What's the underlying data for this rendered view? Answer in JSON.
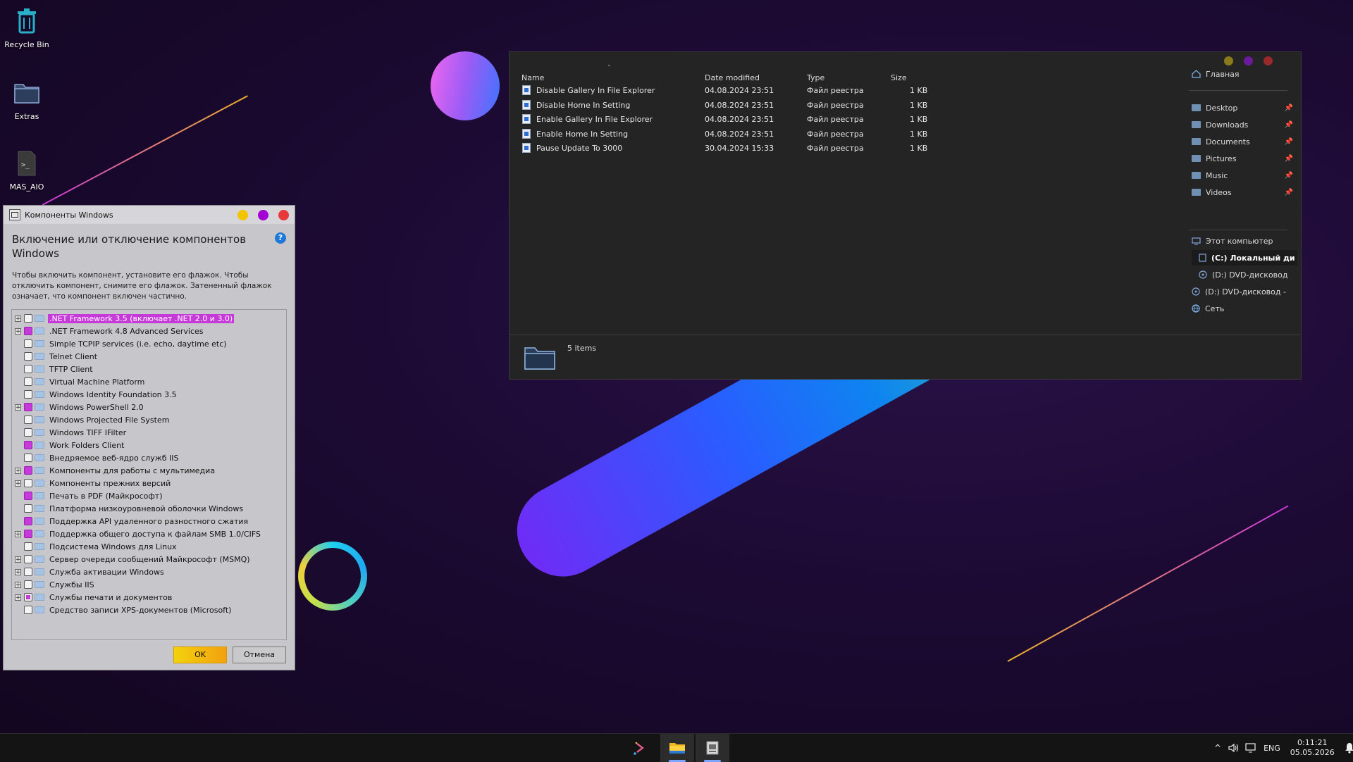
{
  "desktop": {
    "icons": [
      {
        "label": "Recycle Bin",
        "icon": "recycle-bin-icon"
      },
      {
        "label": "Extras",
        "icon": "folder-icon"
      },
      {
        "label": "MAS_AIO",
        "icon": "script-file-icon"
      }
    ]
  },
  "features_dialog": {
    "title": "Компоненты Windows",
    "heading": "Включение или отключение компонентов Windows",
    "description": "Чтобы включить компонент, установите его флажок. Чтобы отключить компонент, снимите его флажок. Затененный флажок означает, что компонент включен частично.",
    "help_symbol": "?",
    "items": [
      {
        "label": ".NET Framework 3.5 (включает .NET 2.0 и 3.0)",
        "expandable": true,
        "state": "none",
        "selected": true
      },
      {
        "label": ".NET Framework 4.8 Advanced Services",
        "expandable": true,
        "state": "full"
      },
      {
        "label": "Simple TCPIP services (i.e. echo, daytime etc)",
        "expandable": false,
        "state": "none"
      },
      {
        "label": "Telnet Client",
        "expandable": false,
        "state": "none"
      },
      {
        "label": "TFTP Client",
        "expandable": false,
        "state": "none"
      },
      {
        "label": "Virtual Machine Platform",
        "expandable": false,
        "state": "none"
      },
      {
        "label": "Windows Identity Foundation 3.5",
        "expandable": false,
        "state": "none"
      },
      {
        "label": "Windows PowerShell 2.0",
        "expandable": true,
        "state": "full"
      },
      {
        "label": "Windows Projected File System",
        "expandable": false,
        "state": "none"
      },
      {
        "label": "Windows TIFF IFilter",
        "expandable": false,
        "state": "none"
      },
      {
        "label": "Work Folders Client",
        "expandable": false,
        "state": "full"
      },
      {
        "label": "Внедряемое веб-ядро служб IIS",
        "expandable": false,
        "state": "none"
      },
      {
        "label": "Компоненты для работы с мультимедиа",
        "expandable": true,
        "state": "full"
      },
      {
        "label": "Компоненты прежних версий",
        "expandable": true,
        "state": "none"
      },
      {
        "label": "Печать в PDF (Майкрософт)",
        "expandable": false,
        "state": "full"
      },
      {
        "label": "Платформа низкоуровневой оболочки Windows",
        "expandable": false,
        "state": "none"
      },
      {
        "label": "Поддержка API удаленного разностного сжатия",
        "expandable": false,
        "state": "full"
      },
      {
        "label": "Поддержка общего доступа к файлам SMB 1.0/CIFS",
        "expandable": true,
        "state": "full"
      },
      {
        "label": "Подсистема Windows для Linux",
        "expandable": false,
        "state": "none"
      },
      {
        "label": "Сервер очереди сообщений Майкрософт (MSMQ)",
        "expandable": true,
        "state": "none"
      },
      {
        "label": "Служба активации Windows",
        "expandable": true,
        "state": "none"
      },
      {
        "label": "Службы IIS",
        "expandable": true,
        "state": "none"
      },
      {
        "label": "Службы печати и документов",
        "expandable": true,
        "state": "partial"
      },
      {
        "label": "Средство записи XPS-документов (Microsoft)",
        "expandable": false,
        "state": "none"
      }
    ],
    "ok_label": "OK",
    "cancel_label": "Отмена"
  },
  "window_controls": {
    "minimize_color": "#f2c400",
    "maximize_color": "#a400d6",
    "close_color": "#e83a3a",
    "explorer_minimize_color": "#8a7a1a",
    "explorer_maximize_color": "#6a1a9a",
    "explorer_close_color": "#9a2a2a"
  },
  "explorer": {
    "columns": {
      "name": "Name",
      "date": "Date modified",
      "type": "Type",
      "size": "Size",
      "sort_indicator": "˄"
    },
    "files": [
      {
        "name": "Disable Gallery In File Explorer",
        "date": "04.08.2024 23:51",
        "type": "Файл реестра",
        "size": "1 KB"
      },
      {
        "name": "Disable Home In Setting",
        "date": "04.08.2024 23:51",
        "type": "Файл реестра",
        "size": "1 KB"
      },
      {
        "name": "Enable Gallery In File Explorer",
        "date": "04.08.2024 23:51",
        "type": "Файл реестра",
        "size": "1 KB"
      },
      {
        "name": "Enable Home In Setting",
        "date": "04.08.2024 23:51",
        "type": "Файл реестра",
        "size": "1 KB"
      },
      {
        "name": "Pause Update To 3000",
        "date": "30.04.2024 15:33",
        "type": "Файл реестра",
        "size": "1 KB"
      }
    ],
    "status": "5 items",
    "nav": {
      "home": "Главная",
      "quick_access": [
        "Desktop",
        "Downloads",
        "Documents",
        "Pictures",
        "Music",
        "Videos"
      ],
      "pin_glyph": "📌",
      "this_pc": "Этот компьютер",
      "drive_c": "(C:) Локальный ди",
      "drive_d_sub": "(D:) DVD-дисковод",
      "drive_d": "(D:) DVD-дисковод -",
      "network": "Сеть"
    }
  },
  "taskbar": {
    "language": "ENG",
    "time": "0:11:21",
    "date": "05.05.2026",
    "tray_chevron": "^"
  }
}
